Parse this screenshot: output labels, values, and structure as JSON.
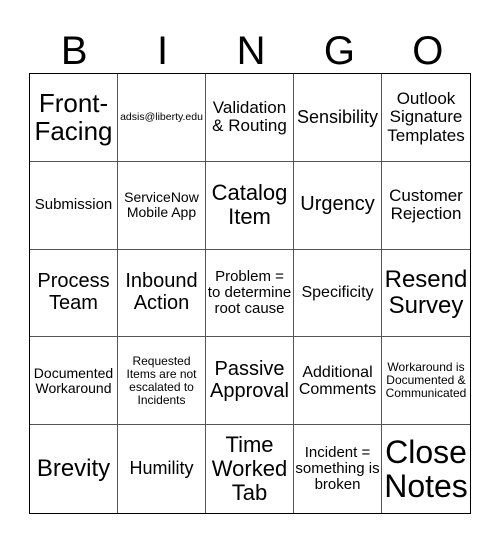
{
  "header": [
    "B",
    "I",
    "N",
    "G",
    "O"
  ],
  "cells": [
    "Front-Facing",
    "adsis@liberty.edu",
    "Validation & Routing",
    "Sensibility",
    "Outlook Signature Templates",
    "Submission",
    "ServiceNow Mobile App",
    "Catalog Item",
    "Urgency",
    "Customer Rejection",
    "Process Team",
    "Inbound Action",
    "Problem = to determine root cause",
    "Specificity",
    "Resend Survey",
    "Documented Workaround",
    "Requested Items are not escalated to Incidents",
    "Passive Approval",
    "Additional Comments",
    "Workaround is Documented & Communicated",
    "Brevity",
    "Humility",
    "Time Worked Tab",
    "Incident = something is broken",
    "Close Notes"
  ]
}
